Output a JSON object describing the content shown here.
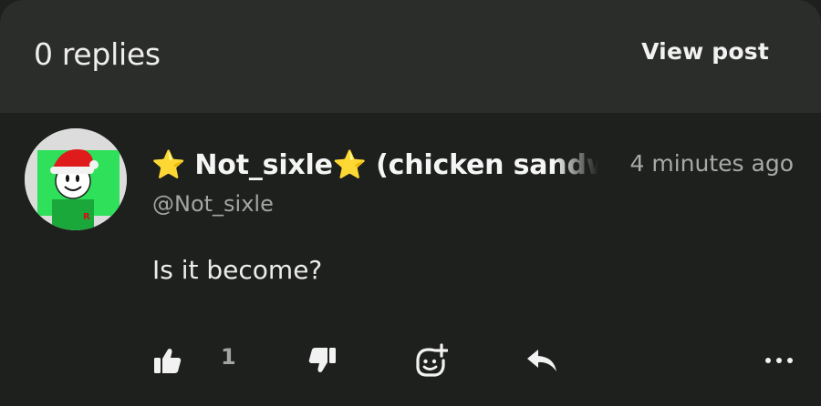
{
  "header": {
    "replies_label": "0 replies",
    "view_post_label": "View post"
  },
  "comment": {
    "display_name": "⭐ Not_sixle⭐  (chicken sandwich",
    "timestamp": "4 minutes ago",
    "handle": "@Not_sixle",
    "body": "Is it become?",
    "like_count": "1"
  },
  "icons": {
    "like": "thumbs-up-icon",
    "dislike": "thumbs-down-icon",
    "react": "add-reaction-icon",
    "reply": "reply-icon",
    "more": "more-options-icon"
  },
  "colors": {
    "header_bg": "#2b2d2a",
    "body_bg": "#1e201d",
    "primary_text": "#f5f5f5",
    "secondary_text": "#a4a5a2"
  }
}
